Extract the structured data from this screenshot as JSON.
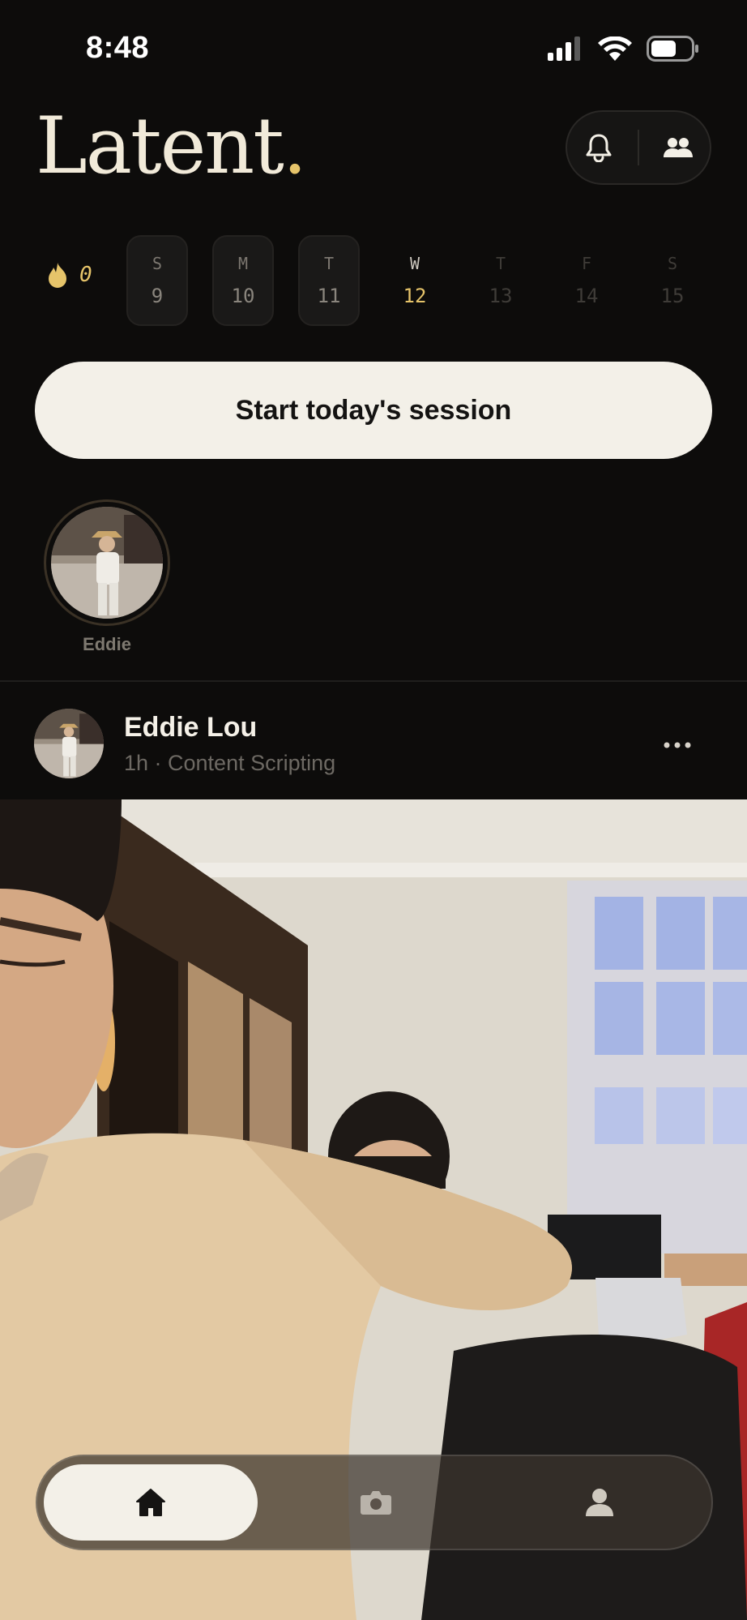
{
  "status_bar": {
    "time": "8:48",
    "icons": [
      "cellular-icon",
      "wifi-icon",
      "battery-icon"
    ]
  },
  "header": {
    "logo_text": "Latent",
    "logo_dot": ".",
    "actions": [
      "bell-icon",
      "friends-icon"
    ]
  },
  "streak": {
    "icon": "flame-icon",
    "count": "0"
  },
  "week": [
    {
      "dow": "S",
      "num": "9",
      "state": "past"
    },
    {
      "dow": "M",
      "num": "10",
      "state": "past"
    },
    {
      "dow": "T",
      "num": "11",
      "state": "past"
    },
    {
      "dow": "W",
      "num": "12",
      "state": "today"
    },
    {
      "dow": "T",
      "num": "13",
      "state": "future"
    },
    {
      "dow": "F",
      "num": "14",
      "state": "future"
    },
    {
      "dow": "S",
      "num": "15",
      "state": "future"
    }
  ],
  "cta": {
    "label": "Start today's session"
  },
  "stories": [
    {
      "name": "Eddie"
    }
  ],
  "post": {
    "author": "Eddie Lou",
    "meta": "1h · Content Scripting",
    "more_icon": "more-horizontal-icon"
  },
  "tabbar": {
    "tabs": [
      {
        "icon": "home-icon",
        "active": true
      },
      {
        "icon": "camera-icon",
        "active": false
      },
      {
        "icon": "profile-icon",
        "active": false
      }
    ]
  },
  "colors": {
    "accent": "#e6c46a",
    "background": "#0d0c0b",
    "cream": "#f3f0e8"
  }
}
